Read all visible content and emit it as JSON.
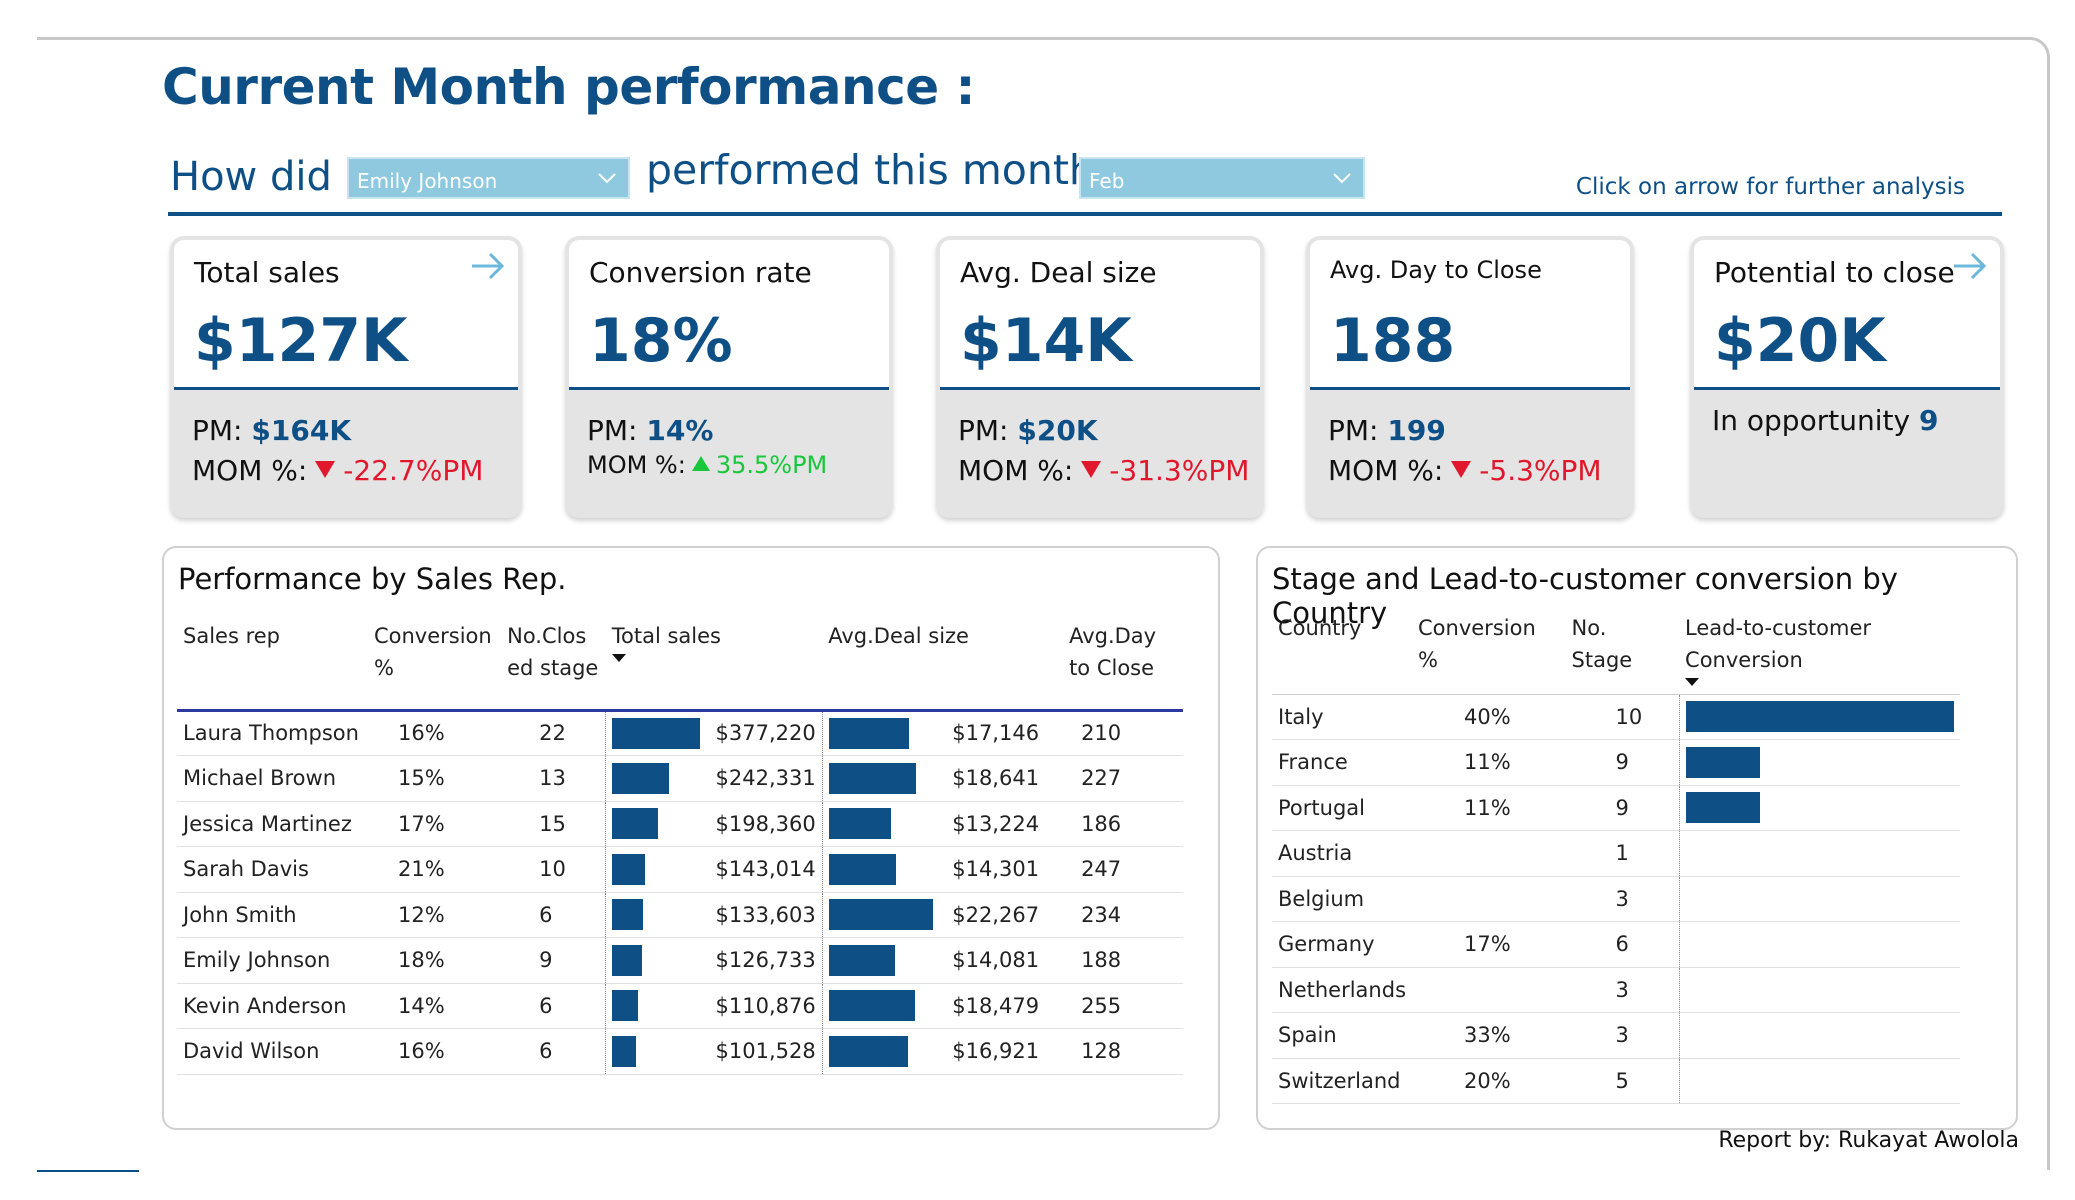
{
  "header": {
    "title": "Current Month performance  :",
    "how_did": "How did",
    "rep_select": "Emily Johnson",
    "performed": "performed this month",
    "month_select": "Feb",
    "hint": "Click on arrow for further analysis"
  },
  "kpis": {
    "total_sales": {
      "label": "Total sales",
      "value": "$127K",
      "pm_label": "PM:",
      "pm_value": "$164K",
      "mom_label": "MOM %:",
      "mom_value": "-22.7%PM"
    },
    "conversion": {
      "label": "Conversion rate",
      "value": "18%",
      "pm_label": "PM:",
      "pm_value": "14%",
      "mom_label": "MOM %:",
      "mom_value": "35.5%PM"
    },
    "deal_size": {
      "label": "Avg. Deal size",
      "value": "$14K",
      "pm_label": "PM:",
      "pm_value": "$20K",
      "mom_label": "MOM %:",
      "mom_value": "-31.3%PM"
    },
    "day_close": {
      "label": "Avg. Day to Close",
      "value": "188",
      "pm_label": "PM:",
      "pm_value": "199",
      "mom_label": "MOM %:",
      "mom_value": "-5.3%PM"
    },
    "potential": {
      "label": "Potential to close",
      "value": "$20K",
      "opp_label": "In opportunity",
      "opp_value": "9"
    }
  },
  "sales_table": {
    "title": "Performance by Sales Rep.",
    "headers": {
      "rep": "Sales rep",
      "conv": "Conversion %",
      "closed": "No.Clos ed stage",
      "total": "Total sales",
      "deal": "Avg.Deal size",
      "days": "Avg.Day to Close"
    },
    "rows": [
      {
        "rep": "Laura Thompson",
        "conv": "16%",
        "closed": "22",
        "total": "$377,220",
        "total_num": 377220,
        "deal": "$17,146",
        "deal_num": 17146,
        "days": "210"
      },
      {
        "rep": "Michael Brown",
        "conv": "15%",
        "closed": "13",
        "total": "$242,331",
        "total_num": 242331,
        "deal": "$18,641",
        "deal_num": 18641,
        "days": "227"
      },
      {
        "rep": "Jessica Martinez",
        "conv": "17%",
        "closed": "15",
        "total": "$198,360",
        "total_num": 198360,
        "deal": "$13,224",
        "deal_num": 13224,
        "days": "186"
      },
      {
        "rep": "Sarah Davis",
        "conv": "21%",
        "closed": "10",
        "total": "$143,014",
        "total_num": 143014,
        "deal": "$14,301",
        "deal_num": 14301,
        "days": "247"
      },
      {
        "rep": "John Smith",
        "conv": "12%",
        "closed": "6",
        "total": "$133,603",
        "total_num": 133603,
        "deal": "$22,267",
        "deal_num": 22267,
        "days": "234"
      },
      {
        "rep": "Emily Johnson",
        "conv": "18%",
        "closed": "9",
        "total": "$126,733",
        "total_num": 126733,
        "deal": "$14,081",
        "deal_num": 14081,
        "days": "188"
      },
      {
        "rep": "Kevin Anderson",
        "conv": "14%",
        "closed": "6",
        "total": "$110,876",
        "total_num": 110876,
        "deal": "$18,479",
        "deal_num": 18479,
        "days": "255"
      },
      {
        "rep": "David Wilson",
        "conv": "16%",
        "closed": "6",
        "total": "$101,528",
        "total_num": 101528,
        "deal": "$16,921",
        "deal_num": 16921,
        "days": "128"
      }
    ]
  },
  "country_table": {
    "title": "Stage and Lead-to-customer conversion by Country",
    "headers": {
      "country": "Country",
      "conv": "Conversion %",
      "stage": "No. Stage",
      "l2c": "Lead-to-customer Conversion"
    },
    "rows": [
      {
        "country": "Italy",
        "conv": "40%",
        "stage": "10",
        "l2c": 0.4
      },
      {
        "country": "France",
        "conv": "11%",
        "stage": "9",
        "l2c": 0.11
      },
      {
        "country": "Portugal",
        "conv": "11%",
        "stage": "9",
        "l2c": 0.11
      },
      {
        "country": "Austria",
        "conv": "",
        "stage": "1",
        "l2c": 0
      },
      {
        "country": "Belgium",
        "conv": "",
        "stage": "3",
        "l2c": 0
      },
      {
        "country": "Germany",
        "conv": "17%",
        "stage": "6",
        "l2c": 0
      },
      {
        "country": "Netherlands",
        "conv": "",
        "stage": "3",
        "l2c": 0
      },
      {
        "country": "Spain",
        "conv": "33%",
        "stage": "3",
        "l2c": 0
      },
      {
        "country": "Switzerland",
        "conv": "20%",
        "stage": "5",
        "l2c": 0
      }
    ]
  },
  "footer": "Report by: Rukayat Awolola",
  "colors": {
    "accent": "#0e4f86",
    "negative": "#e1172c",
    "positive": "#19c73a"
  },
  "icons": [
    "help-icon",
    "home-icon",
    "analysis-icon",
    "alarm-clock-icon",
    "arrow-right-icon",
    "chevron-down-icon"
  ]
}
